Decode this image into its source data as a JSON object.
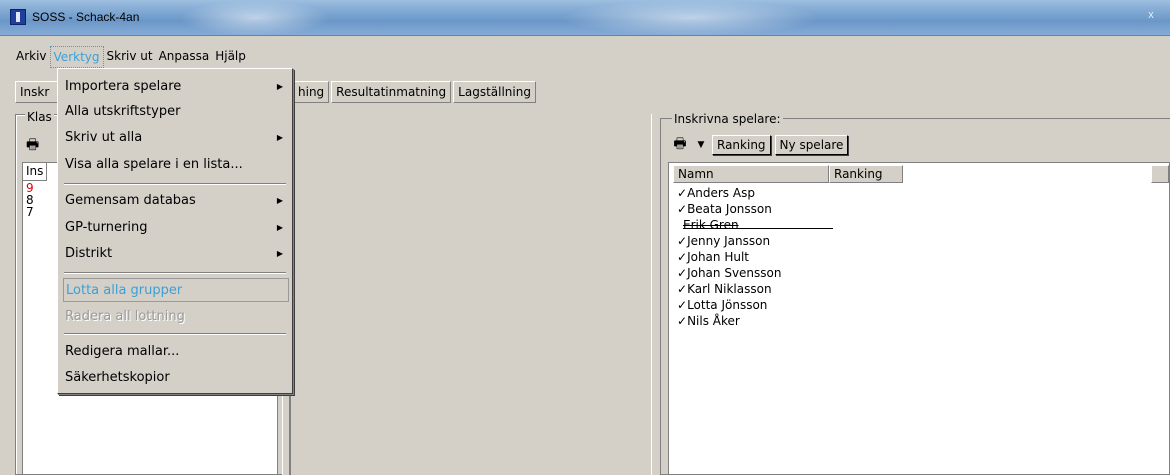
{
  "window": {
    "title": "SOSS - Schack-4an",
    "close_glyph": "x"
  },
  "menubar": {
    "items": [
      "Arkiv",
      "Verktyg",
      "Skriv ut",
      "Anpassa",
      "Hjälp"
    ],
    "active": "Verktyg"
  },
  "tabs": {
    "first": "Inskr",
    "rest": [
      "hing",
      "Resultatinmatning",
      "Lagställning"
    ]
  },
  "left_panel": {
    "legend": "Klas",
    "list_header": "Ins",
    "rows": [
      {
        "value": "9",
        "color": "#e00000"
      },
      {
        "value": "8",
        "color": "#000000"
      },
      {
        "value": "7",
        "color": "#000000"
      }
    ]
  },
  "right_panel": {
    "legend": "Inskrivna spelare:",
    "toolbar": {
      "ranking_button": "Ranking",
      "new_player_button": "Ny spelare"
    },
    "columns": [
      "Namn",
      "Ranking"
    ],
    "players": [
      {
        "check": "✓",
        "name": "Anders Asp",
        "struck": false
      },
      {
        "check": "✓",
        "name": "Beata Jonsson",
        "struck": false
      },
      {
        "check": "",
        "name": "Erik Gren",
        "struck": true
      },
      {
        "check": "✓",
        "name": "Jenny Jansson",
        "struck": false
      },
      {
        "check": "✓",
        "name": "Johan Hult",
        "struck": false
      },
      {
        "check": "✓",
        "name": "Johan Svensson",
        "struck": false
      },
      {
        "check": "✓",
        "name": "Karl Niklasson",
        "struck": false
      },
      {
        "check": "✓",
        "name": "Lotta Jönsson",
        "struck": false
      },
      {
        "check": "✓",
        "name": "Nils Åker",
        "struck": false
      }
    ]
  },
  "dropdown": {
    "items": [
      {
        "label": "Importera spelare",
        "submenu": true
      },
      {
        "label": "Alla utskriftstyper",
        "submenu": false
      },
      {
        "label": "Skriv ut alla",
        "submenu": true
      },
      {
        "label": "Visa alla spelare i en lista...",
        "submenu": false
      },
      {
        "label": "Gemensam databas",
        "submenu": true
      },
      {
        "label": "GP-turnering",
        "submenu": true
      },
      {
        "label": "Distrikt",
        "submenu": true
      },
      {
        "label": "Lotta alla grupper",
        "state": "highlight"
      },
      {
        "label": "Radera all lottning",
        "state": "disabled"
      },
      {
        "label": "Redigera mallar...",
        "submenu": false
      },
      {
        "label": "Säkerhetskopior",
        "submenu": false
      }
    ],
    "submenu_arrow": "▶"
  },
  "icons": {
    "printer": "🖶",
    "dropdown_arrow": "▼"
  }
}
